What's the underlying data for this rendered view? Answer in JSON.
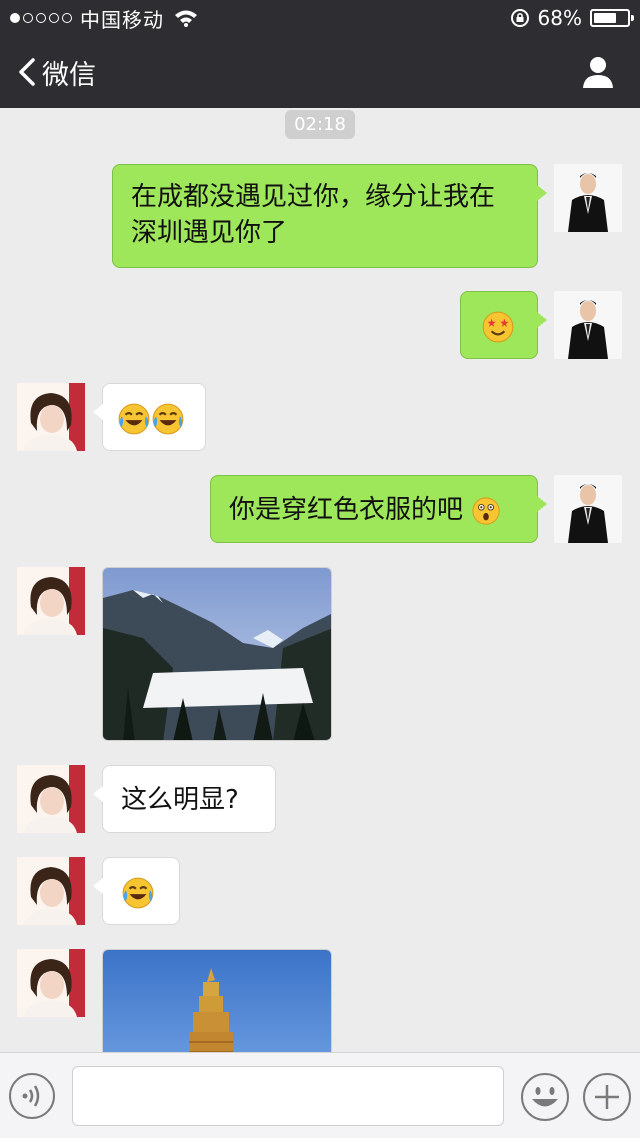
{
  "status_bar": {
    "carrier": "中国移动",
    "battery_percent_text": "68%",
    "battery_level": 0.68,
    "signal_strength": 1
  },
  "nav": {
    "back_label": "微信",
    "back_icon": "chevron-left-icon",
    "profile_icon": "person-icon"
  },
  "chat": {
    "timestamp": "02:18",
    "messages": [
      {
        "from": "me",
        "type": "text",
        "text": "在成都没遇见过你，缘分让我在深圳遇见你了"
      },
      {
        "from": "me",
        "type": "emoji",
        "emoji": "star-struck-face"
      },
      {
        "from": "her",
        "type": "emoji",
        "emoji": [
          "crying-laughing-face",
          "crying-laughing-face"
        ]
      },
      {
        "from": "me",
        "type": "text",
        "text": "你是穿红色衣服的吧",
        "emoji": "surprised-face"
      },
      {
        "from": "her",
        "type": "image",
        "image": "snowy-mountain-lake-photo"
      },
      {
        "from": "her",
        "type": "text",
        "text": "这么明显?"
      },
      {
        "from": "her",
        "type": "emoji",
        "emoji": "crying-laughing-face"
      },
      {
        "from": "her",
        "type": "image",
        "image": "golden-statue-blue-sky-photo"
      }
    ]
  },
  "input_bar": {
    "voice_icon": "voice-icon",
    "text_value": "",
    "emoji_icon": "smiley-icon",
    "more_icon": "plus-icon"
  },
  "colors": {
    "topbar": "#2e2e32",
    "chat_background": "#ececec",
    "sent_bubble": "#9ee65a",
    "received_bubble": "#ffffff"
  }
}
